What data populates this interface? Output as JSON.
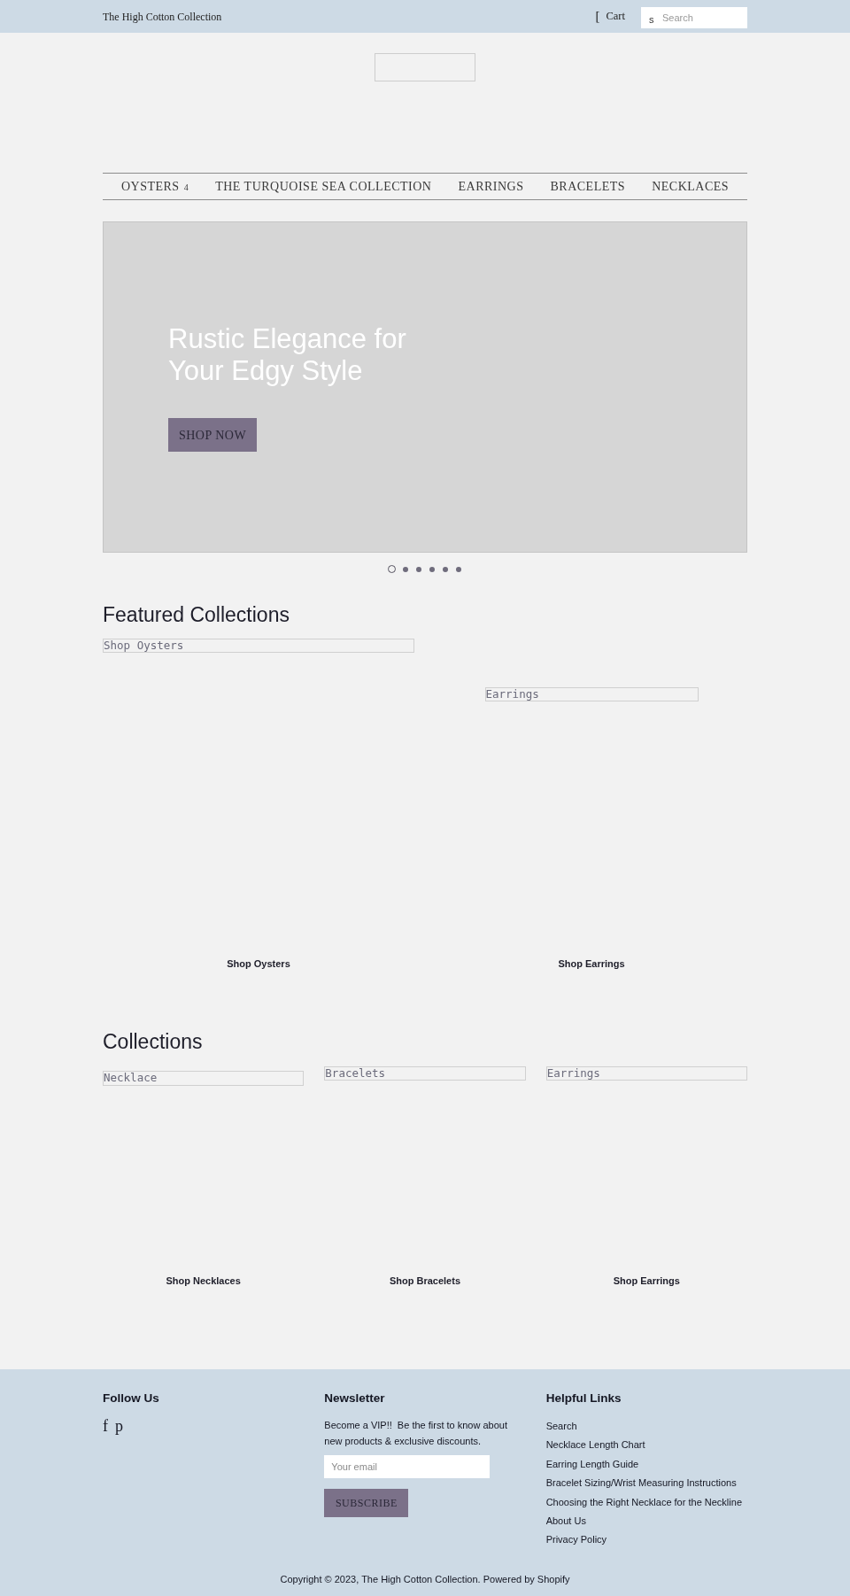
{
  "top_bar": {
    "store_name": "The High Cotton Collection",
    "cart_glyph": "[",
    "cart_label": "Cart",
    "search_glyph": "s",
    "search_placeholder": "Search"
  },
  "nav": [
    {
      "label": "OYSTERS",
      "dropdown_glyph": "4"
    },
    {
      "label": "THE TURQUOISE SEA COLLECTION"
    },
    {
      "label": "EARRINGS"
    },
    {
      "label": "BRACELETS"
    },
    {
      "label": "NECKLACES"
    }
  ],
  "hero": {
    "title": "Rustic Elegance for Your Edgy Style",
    "button": "SHOP NOW",
    "dots": [
      {
        "selected": true
      },
      {
        "selected": false
      },
      {
        "selected": false
      },
      {
        "selected": false
      },
      {
        "selected": false
      },
      {
        "selected": false
      }
    ]
  },
  "featured": {
    "heading": "Featured Collections",
    "items": [
      {
        "image_alt": "Shop Oysters",
        "label": "Shop Oysters"
      },
      {
        "image_alt": "Earrings",
        "label": "Shop Earrings"
      }
    ]
  },
  "collections": {
    "heading": "Collections",
    "items": [
      {
        "image_alt": "Necklace",
        "label": "Shop Necklaces"
      },
      {
        "image_alt": "Bracelets",
        "label": "Shop Bracelets"
      },
      {
        "image_alt": "Earrings",
        "label": "Shop Earrings"
      }
    ]
  },
  "footer": {
    "follow": {
      "heading": "Follow Us",
      "social": [
        "f",
        "p"
      ]
    },
    "newsletter": {
      "heading": "Newsletter",
      "text": "Become a VIP!!  Be the first to know about new products & exclusive discounts.",
      "email_placeholder": "Your email",
      "button": "SUBSCRIBE"
    },
    "links": {
      "heading": "Helpful Links",
      "items": [
        "Search",
        "Necklace Length Chart",
        "Earring Length Guide",
        "Bracelet Sizing/Wrist Measuring Instructions",
        "Choosing the Right Necklace for the Neckline",
        "About Us",
        "Privacy Policy"
      ]
    },
    "copyright": "Copyright © 2023, The High Cotton Collection. Powered by Shopify"
  }
}
